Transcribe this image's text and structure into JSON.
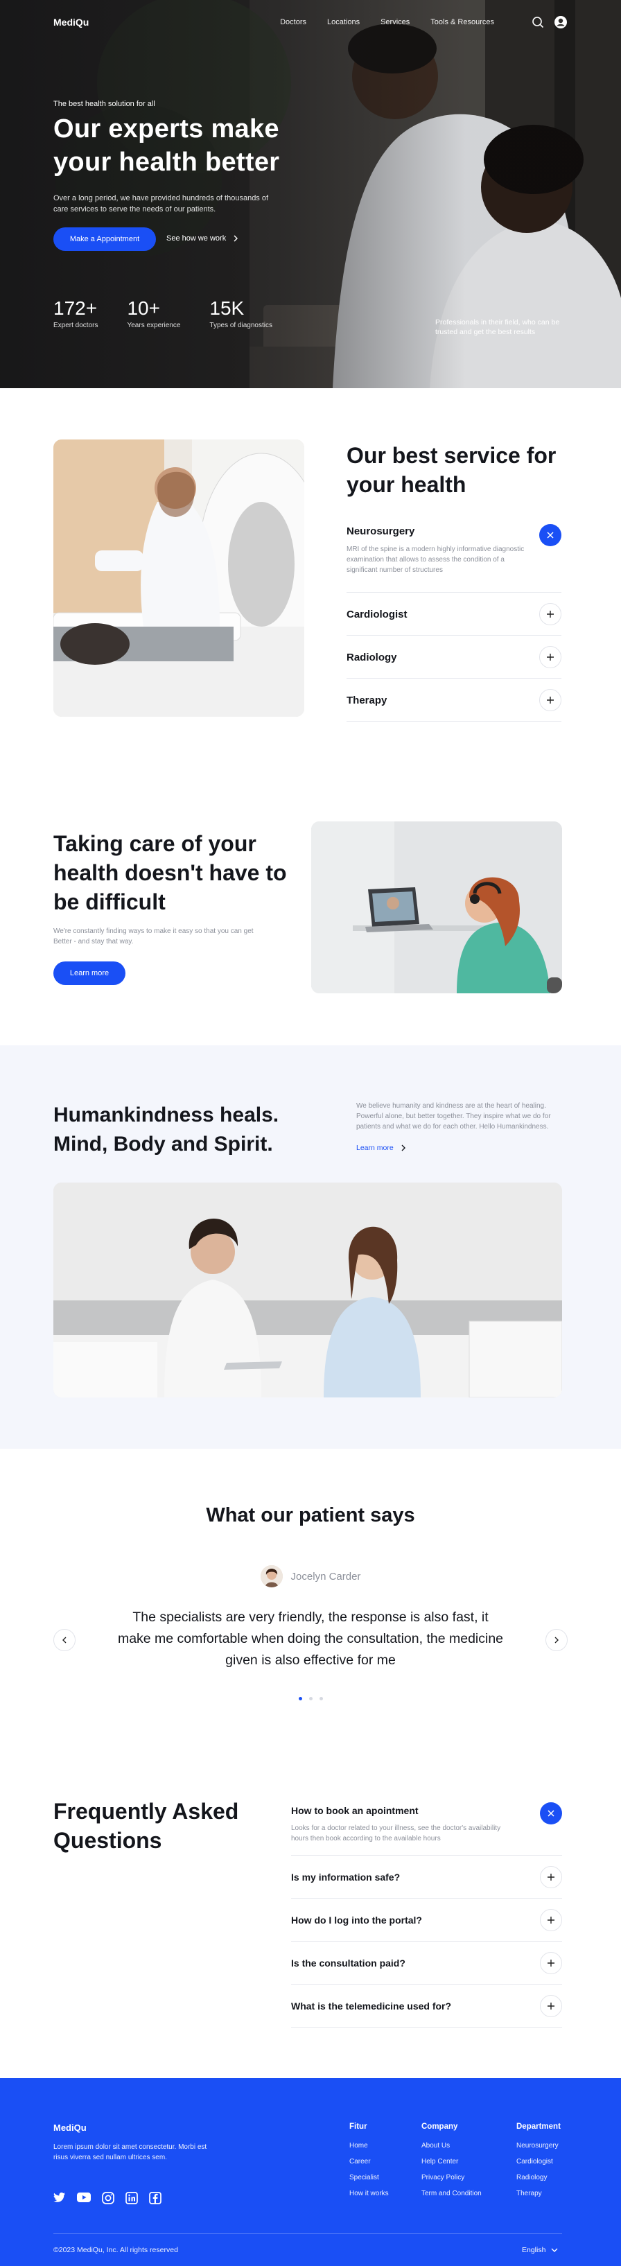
{
  "brand": {
    "accent": "#1a4ff5",
    "name": "MediQu"
  },
  "nav": {
    "logo": "MediQu",
    "links": [
      "Doctors",
      "Locations",
      "Services",
      "Tools & Resources"
    ],
    "icons": [
      "search-icon",
      "user-icon"
    ]
  },
  "hero": {
    "eyebrow": "The best health solution for all",
    "title": "Our experts make your health better",
    "lead": "Over a long period, we have provided hundreds of thousands of care services to serve the needs of our patients.",
    "cta": "Make a Appointment",
    "secondary": "See how we work",
    "stats": [
      {
        "value": "172+",
        "label": "Expert doctors"
      },
      {
        "value": "10+",
        "label": "Years experience"
      },
      {
        "value": "15K",
        "label": "Types of diagnostics"
      }
    ],
    "tag": "Professionals in their field, who can be trusted and get the best results"
  },
  "services": {
    "title": "Our best service for your health",
    "items": [
      {
        "label": "Neurosurgery",
        "desc": "MRI of the spine is a modern highly informative diagnostic examination that allows to assess the condition of a significant number of structures",
        "open": true
      },
      {
        "label": "Cardiologist",
        "open": false
      },
      {
        "label": "Radiology",
        "open": false
      },
      {
        "label": "Therapy",
        "open": false
      }
    ]
  },
  "care": {
    "title": "Taking care of your health doesn't have to be difficult",
    "lead": "We're constantly finding ways to make it easy so that you can get Better - and stay that way.",
    "cta": "Learn more"
  },
  "human": {
    "title": "Humankindness heals. Mind, Body and Spirit.",
    "lead": "We believe humanity and kindness are at the heart of healing. Powerful alone, but better together. They inspire what we do for patients and what we do for each other. Hello Humankindness.",
    "link": "Learn more"
  },
  "testimonial": {
    "title": "What our patient says",
    "name": "Jocelyn Carder",
    "quote": "The specialists are very friendly, the response is also fast, it make me comfortable when doing the consultation, the medicine given is also effective for me",
    "active_slide": 1,
    "slides": 3
  },
  "faq": {
    "title": "Frequently Asked Questions",
    "items": [
      {
        "q": "How to book an apointment",
        "a": "Looks for a doctor related to your illness, see the doctor's availability hours then book according to the available hours",
        "open": true
      },
      {
        "q": "Is my information safe?",
        "open": false
      },
      {
        "q": "How do I log into the portal?",
        "open": false
      },
      {
        "q": "Is the consultation paid?",
        "open": false
      },
      {
        "q": "What is the telemedicine used for?",
        "open": false
      }
    ]
  },
  "footer": {
    "logo": "MediQu",
    "desc": "Lorem ipsum dolor sit amet consectetur. Morbi est risus viverra sed nullam ultrices sem.",
    "social": [
      "twitter-icon",
      "youtube-icon",
      "instagram-icon",
      "linkedin-icon",
      "facebook-icon"
    ],
    "cols": [
      {
        "title": "Fitur",
        "items": [
          "Home",
          "Career",
          "Specialist",
          "How it works"
        ]
      },
      {
        "title": "Company",
        "items": [
          "About Us",
          "Help Center",
          "Privacy Policy",
          "Term and Condition"
        ]
      },
      {
        "title": "Department",
        "items": [
          "Neurosurgery",
          "Cardiologist",
          "Radiology",
          "Therapy"
        ]
      }
    ],
    "copyright": "©2023 MediQu, Inc. All rights reserved",
    "language": "English"
  }
}
